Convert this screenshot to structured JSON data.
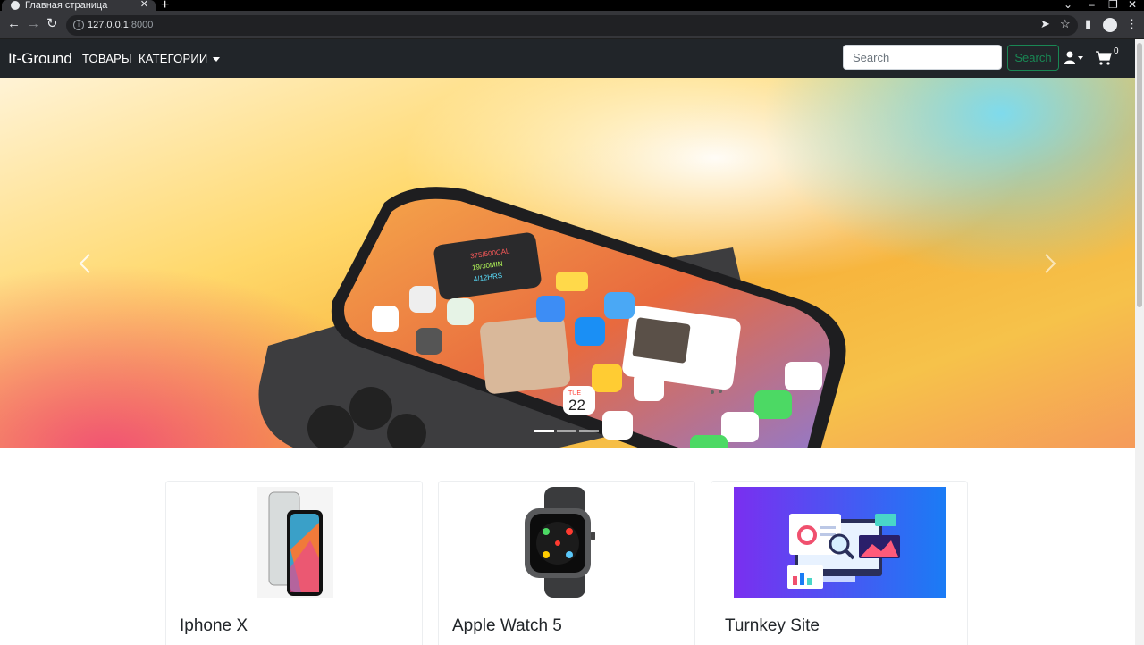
{
  "browser": {
    "tab_title": "Главная страница",
    "url_host": "127.0.0.1",
    "url_rest": ":8000"
  },
  "navbar": {
    "brand": "It-Ground",
    "links": [
      {
        "label": "ТОВАРЫ"
      },
      {
        "label": "КАТЕГОРИИ"
      }
    ],
    "search_placeholder": "Search",
    "search_button": "Search",
    "cart_count": "0"
  },
  "carousel": {
    "slide_count": 3,
    "active_index": 0,
    "phone_widgets": {
      "activity_lines": [
        "375/500CAL",
        "19/30MIN",
        "4/12HRS"
      ],
      "calendar_day": "22",
      "calendar_weekday": "TUE"
    }
  },
  "products": [
    {
      "title": "Iphone X"
    },
    {
      "title": "Apple Watch 5"
    },
    {
      "title": "Turnkey Site"
    }
  ],
  "colors": {
    "navbar_bg": "#212529",
    "search_button": "#198754",
    "browser_chrome": "#35363a"
  }
}
